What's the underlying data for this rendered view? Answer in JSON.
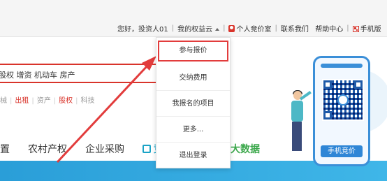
{
  "topnav": {
    "greeting": "您好，投资人01",
    "my_rights": "我的权益云",
    "bidding_room": "个人竞价室",
    "contact": "联系我们",
    "help": "帮助中心",
    "mobile": "手机版"
  },
  "search": {
    "hint": "股权 增资 机动车 房产"
  },
  "categories": [
    {
      "label": "械",
      "color": "#999999"
    },
    {
      "label": "出租",
      "color": "#d9342b"
    },
    {
      "label": "资产",
      "color": "#999999"
    },
    {
      "label": "股权",
      "color": "#d9342b"
    },
    {
      "label": "科技",
      "color": "#999999"
    }
  ],
  "mainnav": {
    "item0": "置",
    "item1": "农村产权",
    "item2": "企业采购",
    "item3": "竞",
    "bigdata": "大数据"
  },
  "dropdown": {
    "items": [
      "参与报价",
      "交纳费用",
      "我报名的项目",
      "更多...",
      "退出登录"
    ]
  },
  "phone": {
    "button_label": "手机竞价"
  },
  "colors": {
    "accent_red": "#d9342b",
    "blue": "#2f86d6",
    "green": "#3aa74a"
  }
}
